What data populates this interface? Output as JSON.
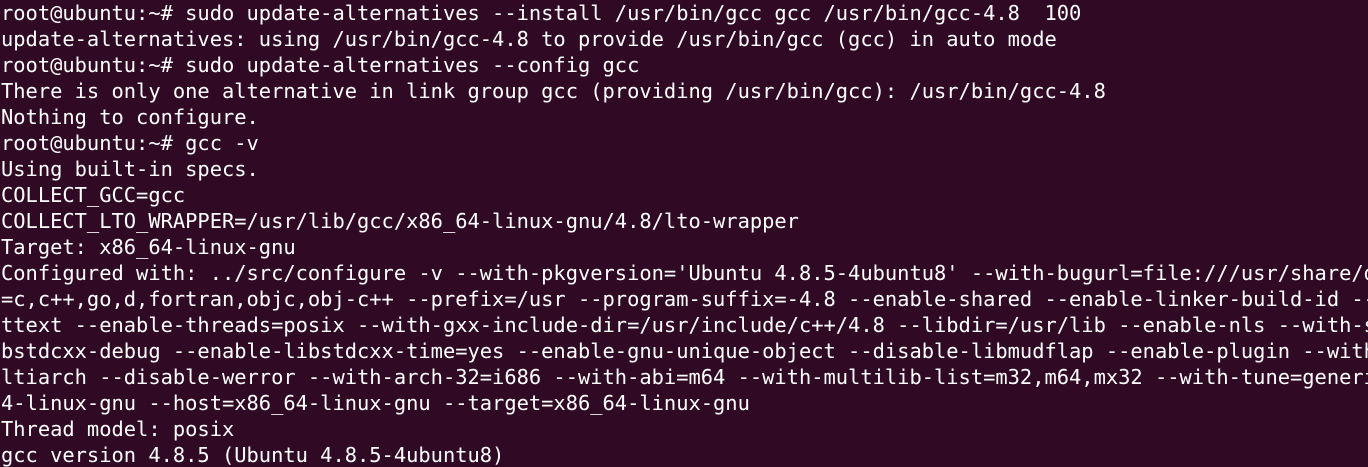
{
  "terminal": {
    "lines": [
      "root@ubuntu:~# sudo update-alternatives --install /usr/bin/gcc gcc /usr/bin/gcc-4.8  100",
      "update-alternatives: using /usr/bin/gcc-4.8 to provide /usr/bin/gcc (gcc) in auto mode",
      "root@ubuntu:~# sudo update-alternatives --config gcc",
      "There is only one alternative in link group gcc (providing /usr/bin/gcc): /usr/bin/gcc-4.8",
      "Nothing to configure.",
      "root@ubuntu:~# gcc -v",
      "Using built-in specs.",
      "COLLECT_GCC=gcc",
      "COLLECT_LTO_WRAPPER=/usr/lib/gcc/x86_64-linux-gnu/4.8/lto-wrapper",
      "Target: x86_64-linux-gnu",
      "Configured with: ../src/configure -v --with-pkgversion='Ubuntu 4.8.5-4ubuntu8' --with-bugurl=file:///usr/share/doc",
      "=c,c++,go,d,fortran,objc,obj-c++ --prefix=/usr --program-suffix=-4.8 --enable-shared --enable-linker-build-id --li",
      "ttext --enable-threads=posix --with-gxx-include-dir=/usr/include/c++/4.8 --libdir=/usr/lib --enable-nls --with-sys",
      "bstdcxx-debug --enable-libstdcxx-time=yes --enable-gnu-unique-object --disable-libmudflap --enable-plugin --with-s",
      "ltiarch --disable-werror --with-arch-32=i686 --with-abi=m64 --with-multilib-list=m32,m64,mx32 --with-tune=generic",
      "4-linux-gnu --host=x86_64-linux-gnu --target=x86_64-linux-gnu",
      "Thread model: posix",
      "gcc version 4.8.5 (Ubuntu 4.8.5-4ubuntu8)"
    ]
  },
  "colors": {
    "background": "#300a24",
    "foreground": "#ffffff"
  }
}
